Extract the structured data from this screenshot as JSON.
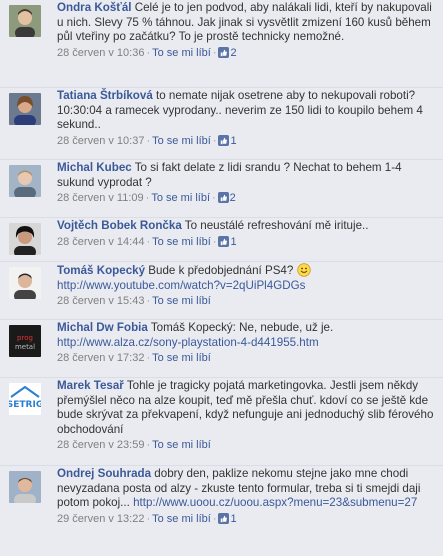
{
  "like_label": "To se mi líbí",
  "comments": [
    {
      "author": "Ondra Košťál",
      "text": "Celé je to jen podvod, aby nalákali lidi, kteří by nakupovali u nich. Slevy 75 % táhnou. Jak jinak si vysvětlit zmizení 160 kusů během půl vteřiny po začátku? To je prostě technicky nemožné.",
      "time": "28 červen v 10:36",
      "likes": "2",
      "avatar": "person-avatar-icon"
    },
    {
      "author": "Tatiana Štrbíková",
      "text": "to nemate nijak osetrene aby to nekupovali roboti? 10:30:04 a ramecek vyprodany.. neverim ze 150 lidi to koupilo behem 4 sekund..",
      "time": "28 červen v 10:37",
      "likes": "1",
      "avatar": "person-avatar-icon"
    },
    {
      "author": "Michal Kubec",
      "text": "To si fakt delate z lidi srandu ? Nechat to behem 1-4 sukund vyprodat ?",
      "time": "28 červen v 11:09",
      "likes": "2",
      "avatar": "person-avatar-icon"
    },
    {
      "author": "Vojtěch Bobek Rončka",
      "text": "To neustálé refreshování mě irituje..",
      "time": "28 červen v 14:44",
      "likes": "1",
      "avatar": "person-avatar-icon"
    },
    {
      "author": "Tomáš Kopecký",
      "text": "Bude k předobjednání PS4?",
      "link": "http://www.youtube.com/watch?v=2qUiPl4GDGs",
      "time": "28 červen v 15:43",
      "likes": "",
      "avatar": "person-avatar-icon"
    },
    {
      "author": "Michal Dw Fobia",
      "text": "Tomáš Kopecký: Ne, nebude, u­ž je.",
      "link": "http://www.alza.cz/sony-playstation-4-d441955.htm",
      "time": "28 červen v 17:32",
      "likes": "",
      "avatar": "logo-avatar-icon"
    },
    {
      "author": "Marek Tesař",
      "text": "Tohle je tragicky pojatá marketingovka. Jestli jsem někdy přemýšlel něco na alze koupit, teď mě přešla chuť. kdoví co se ještě kde bude skrývat za překvapení, když nefunguje ani jednoduchý slib férového obchodování",
      "time": "28 červen v 23:59",
      "likes": "",
      "avatar": "logo-avatar-icon"
    },
    {
      "author": "Ondrej Souhrada",
      "text": "dobry den, paklize nekomu stejne jako mne chodi nevyzadana posta od alzy - zkuste tento formular, treba si ti smejdi daji potom pokoj...",
      "link": "http://www.uoou.cz/uoou.aspx?menu=23&submenu=27",
      "time": "29 červen v 13:22",
      "likes": "1",
      "avatar": "person-avatar-icon"
    }
  ]
}
